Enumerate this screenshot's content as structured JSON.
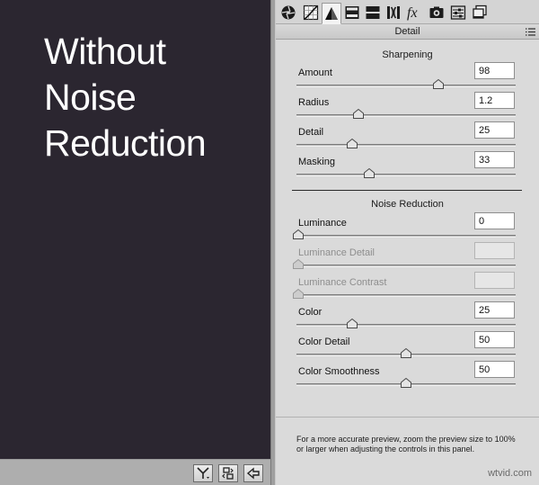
{
  "preview": {
    "overlay_lines": [
      "Without",
      "Noise",
      "Reduction"
    ],
    "background_color": "#2b2630"
  },
  "preview_footer": {
    "buttons": [
      {
        "icon": "before-after-toggle-icon"
      },
      {
        "icon": "swap-settings-icon"
      },
      {
        "icon": "copy-settings-icon"
      }
    ]
  },
  "tabs": [
    {
      "icon": "basic-aperture-icon",
      "active": false
    },
    {
      "icon": "tone-curve-icon",
      "active": false
    },
    {
      "icon": "detail-triangle-icon",
      "active": true
    },
    {
      "icon": "hsl-grayscale-icon",
      "active": false
    },
    {
      "icon": "split-toning-icon",
      "active": false
    },
    {
      "icon": "lens-corrections-icon",
      "active": false
    },
    {
      "icon": "fx-effects-icon",
      "active": false
    },
    {
      "icon": "camera-calibration-icon",
      "active": false
    },
    {
      "icon": "presets-sliders-icon",
      "active": false
    },
    {
      "icon": "snapshots-icon",
      "active": false
    }
  ],
  "panel": {
    "title": "Detail",
    "sharpening": {
      "title": "Sharpening",
      "controls": [
        {
          "label": "Amount",
          "value": "98",
          "level": 0.65,
          "enabled": true
        },
        {
          "label": "Radius",
          "value": "1.2",
          "level": 0.28,
          "enabled": true
        },
        {
          "label": "Detail",
          "value": "25",
          "level": 0.25,
          "enabled": true
        },
        {
          "label": "Masking",
          "value": "33",
          "level": 0.33,
          "enabled": true
        }
      ]
    },
    "noise_reduction": {
      "title": "Noise Reduction",
      "controls": [
        {
          "label": "Luminance",
          "value": "0",
          "level": 0.0,
          "enabled": true
        },
        {
          "label": "Luminance Detail",
          "value": "",
          "level": 0.0,
          "enabled": false
        },
        {
          "label": "Luminance Contrast",
          "value": "",
          "level": 0.0,
          "enabled": false
        },
        {
          "label": "Color",
          "value": "25",
          "level": 0.25,
          "enabled": true
        },
        {
          "label": "Color Detail",
          "value": "50",
          "level": 0.5,
          "enabled": true
        },
        {
          "label": "Color Smoothness",
          "value": "50",
          "level": 0.5,
          "enabled": true
        }
      ]
    },
    "footer_note": "For a more accurate preview, zoom the preview size to 100% or larger when adjusting the controls in this panel."
  },
  "watermark": "wtvid.com"
}
